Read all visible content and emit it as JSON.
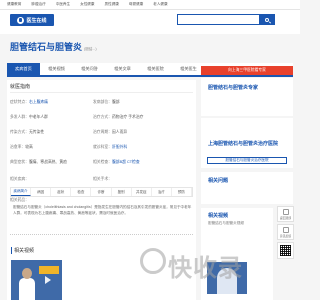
{
  "topnav": {
    "links": [
      "健康教育",
      "肿瘤治疗",
      "中医养生",
      "女性健康",
      "男性健康",
      "母婴健康",
      "老人健康"
    ]
  },
  "header": {
    "logo_text": "医生在线",
    "search_placeholder": ""
  },
  "page": {
    "title": "胆管结石与胆管炎",
    "title_suffix": "(胆结...)"
  },
  "tabs": [
    {
      "label": "疾病首页",
      "active": true
    },
    {
      "label": "相关视频",
      "active": false
    },
    {
      "label": "相关问答",
      "active": false
    },
    {
      "label": "相关文章",
      "active": false
    },
    {
      "label": "相关医院",
      "active": false
    },
    {
      "label": "相关医生",
      "active": false
    }
  ],
  "overview": {
    "heading": "就医指南",
    "rows": [
      {
        "l1": "症状特点：",
        "v1": "右上腹疼痛",
        "l2": "发病部位：",
        "v2": "腹部"
      },
      {
        "l1": "多发人群：",
        "v1": "中老年人群",
        "l2": "治疗方式：",
        "v2": "药物治疗 手术治疗"
      },
      {
        "l1": "传染方式：",
        "v1": "无传染性",
        "l2": "治疗周期：",
        "v2": "因人而异"
      },
      {
        "l1": "治愈率：",
        "v1": "较高",
        "l2": "就诊科室：",
        "v2": "肝胆外科"
      },
      {
        "l1": "典型症状：",
        "v1": "腹痛、寒战高热、黄疸",
        "l2": "相关检查：",
        "v2": "腹部B超 CT检查"
      },
      {
        "l1": "相关疾病：",
        "v1": "",
        "l2": "相关手术：",
        "v2": ""
      },
      {
        "l1": "相关药品：",
        "v1": "",
        "l2": "",
        "v2": ""
      }
    ]
  },
  "subtabs": [
    {
      "label": "疾病简介",
      "active": true
    },
    {
      "label": "病因",
      "active": false
    },
    {
      "label": "症状",
      "active": false
    },
    {
      "label": "检查",
      "active": false
    },
    {
      "label": "诊断",
      "active": false
    },
    {
      "label": "鉴别",
      "active": false
    },
    {
      "label": "并发症",
      "active": false
    },
    {
      "label": "治疗",
      "active": false
    },
    {
      "label": "预防",
      "active": false
    }
  ],
  "intro": {
    "text": "胆管结石与胆管炎（cholelithiasis and cholangitis）是指发生在胆管内的结石及其引发的胆管炎症，常见于中老年人群，可表现为右上腹疼痛、寒战高热、黄疸等症状，需及时就医治疗。"
  },
  "video_section": {
    "heading": "相关视频",
    "thumb_caption": ""
  },
  "sidebar": {
    "red_bar": "向上海三甲医院看专家",
    "expert_title": "胆管结石与胆管炎专家",
    "consult_button": "胆管结石与胆管炎治疗医院",
    "hospital_title": "上海胆管结石与胆管炎治疗医院",
    "hospital_sub": "",
    "related_qa_title": "相关问题",
    "related_video_title": "相关视频",
    "related_video_sub": "胆管结石与胆管炎视频"
  },
  "float_buttons": [
    {
      "label": "返回顶部",
      "icon": "arrow-up-icon"
    },
    {
      "label": "意见反馈",
      "icon": "feedback-icon"
    }
  ],
  "watermark": "快收录"
}
